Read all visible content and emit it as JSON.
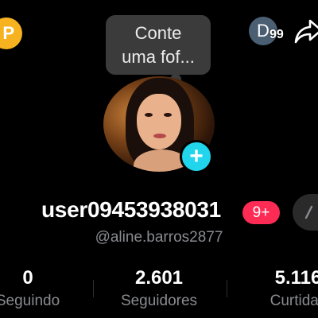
{
  "top_bar": {
    "coin_badge_letter": "P",
    "note_bubble": {
      "line1": "Conte",
      "line2": "uma fof..."
    },
    "friend_avatar_letter": "D",
    "friend_badge_count": "99",
    "share_icon": "share-arrow-icon"
  },
  "profile": {
    "avatar_icon": "profile-photo",
    "add_button_glyph": "+",
    "username": "user09453938031",
    "notification_badge": "9+",
    "handle": "@aline.barros2877"
  },
  "stats": [
    {
      "value": "0",
      "label": "Seguindo"
    },
    {
      "value": "2.601",
      "label": "Seguidores"
    },
    {
      "value": "5.116",
      "label": "Curtidas"
    }
  ],
  "colors": {
    "background": "#000000",
    "accent_cyan": "#20d5ec",
    "badge_red": "#fe2c55",
    "coin_yellow": "#f7b21f",
    "muted_text": "#8a8b91"
  }
}
